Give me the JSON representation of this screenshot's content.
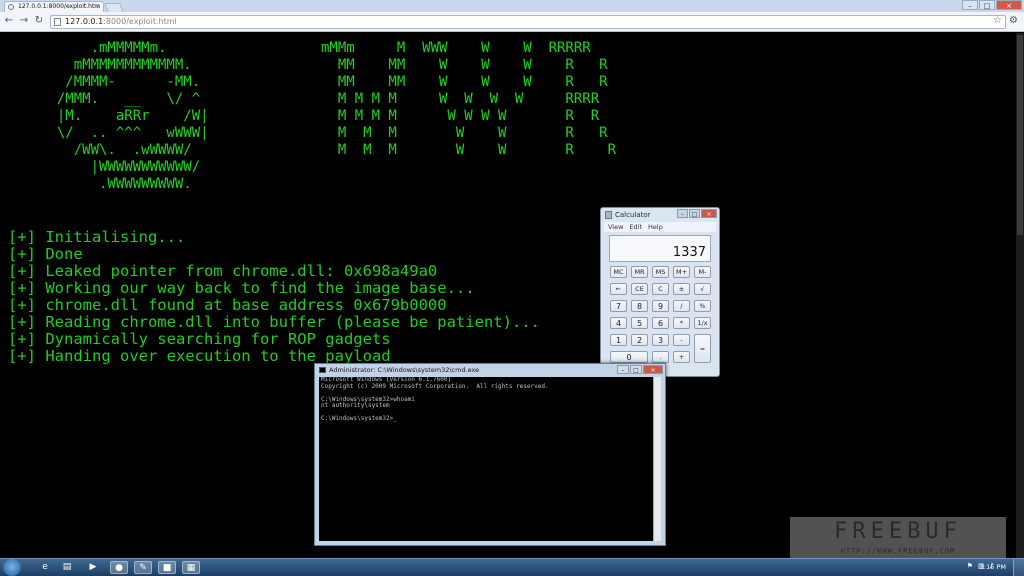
{
  "browser": {
    "tab_title": "127.0.0.1:8000/exploit.htm",
    "url_host": "127.0.0.1",
    "url_rest": ":8000/exploit.html",
    "back_icon": "back-arrow-icon",
    "forward_icon": "forward-arrow-icon",
    "reload_icon": "reload-icon",
    "bookmark_icon": "star-icon",
    "menu_icon": "wrench-icon"
  },
  "page": {
    "ascii_logo": "      .mMMMMMm.\n    mMMMMMMMMMMMM.\n   /MMMM-      -MM.\n  /MMM.        \\/ ^\n  |M.    aR̅R̅r    /W|\n  \\/  .. ^^^   wWWW|\n    /WW\\.  .wWWWW/\n      |WWWWWWWWWWW/\n       .WWWWWWWWW.",
    "ascii_title": "mMMm     M  WWW    W    W  RRRRR\n  MM    MM    W    W    W    R   R\n  MM    MM    W    W    W    R   R\n  M M M M     W  W  W  W     RRRR\n  M M M M      W W W W       R  R\n  M  M  M       W    W       R   R\n  M  M  M       W    W       R    R",
    "log_lines": [
      "[+] Initialising...",
      "[+] Done",
      "[+] Leaked pointer from chrome.dll: 0x698a49a0",
      "[+] Working our way back to find the image base...",
      "[+] chrome.dll found at base address 0x679b0000",
      "[+] Reading chrome.dll into buffer (please be patient)...",
      "[+] Dynamically searching for ROP gadgets",
      "[+] Handing over execution to the payload"
    ]
  },
  "calculator": {
    "title": "Calculator",
    "menu": [
      "View",
      "Edit",
      "Help"
    ],
    "display": "1337",
    "rows": [
      [
        "MC",
        "MR",
        "MS",
        "M+",
        "M-"
      ],
      [
        "←",
        "CE",
        "C",
        "±",
        "√"
      ],
      [
        "7",
        "8",
        "9",
        "/",
        "%"
      ],
      [
        "4",
        "5",
        "6",
        "*",
        "1/x"
      ],
      [
        "1",
        "2",
        "3",
        "-",
        "="
      ],
      [
        "0",
        "",
        ".",
        "+",
        ""
      ]
    ]
  },
  "cmd": {
    "title": "Administrator: C:\\Windows\\system32\\cmd.exe",
    "lines": [
      "Microsoft Windows [Version 6.1.7600]",
      "Copyright (c) 2009 Microsoft Corporation.  All rights reserved.",
      "",
      "C:\\Windows\\system32>whoami",
      "nt authority\\system",
      "",
      "C:\\Windows\\system32>_"
    ]
  },
  "watermark": {
    "big": "FREEBUF",
    "small": "HTTP://WWW.FREEBUF.COM"
  },
  "taskbar": {
    "clock": "3:15 PM",
    "apps": [
      "ie-icon",
      "folder-icon",
      "media-player-icon",
      "chrome-icon",
      "paint-icon",
      "cmd-icon",
      "calculator-icon"
    ],
    "app_glyphs": [
      "e",
      "▤",
      "▶",
      "●",
      "✎",
      "■",
      "▦"
    ]
  }
}
